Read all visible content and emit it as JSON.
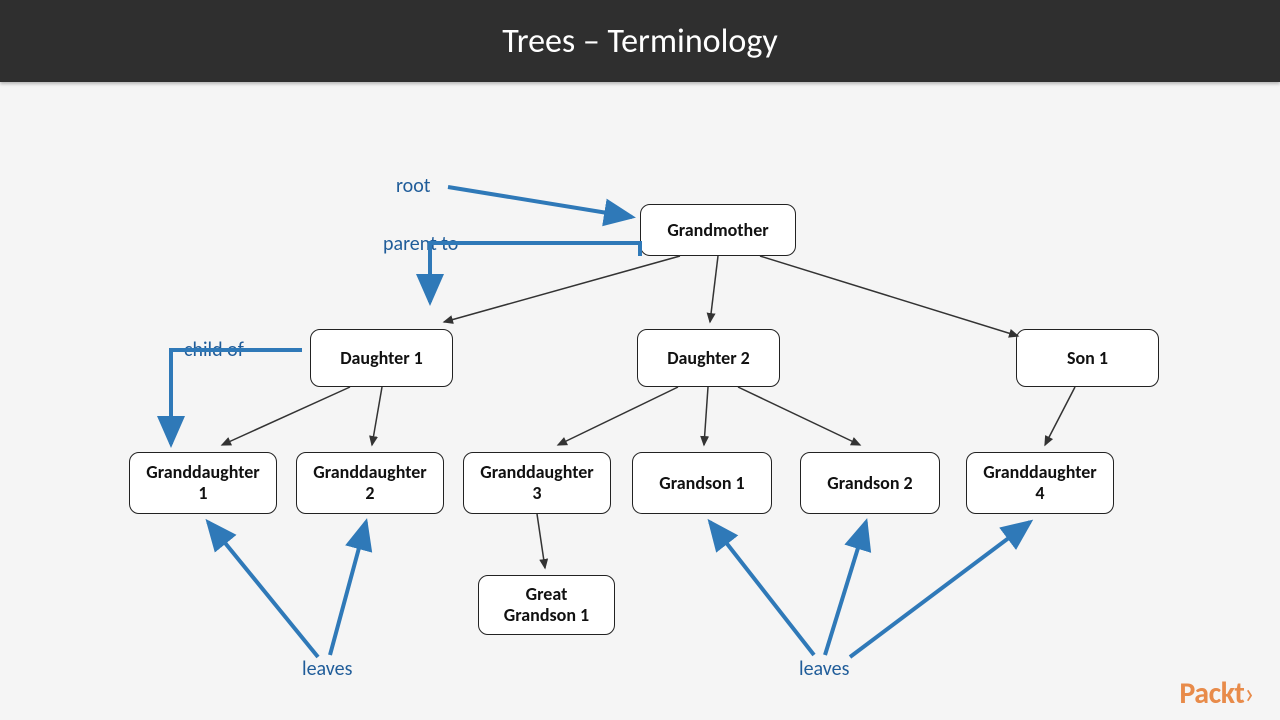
{
  "header": {
    "title": "Trees – Terminology"
  },
  "labels": {
    "root": "root",
    "parent": "parent to",
    "child": "child of",
    "leaves": "leaves"
  },
  "nodes": {
    "grandmother": "Grandmother",
    "daughter1": "Daughter 1",
    "daughter2": "Daughter 2",
    "son1": "Son 1",
    "gd1": "Granddaughter\n1",
    "gd2": "Granddaughter\n2",
    "gd3": "Granddaughter\n3",
    "gs1": "Grandson 1",
    "gs2": "Grandson 2",
    "gd4": "Granddaughter\n4",
    "ggs1": "Great\nGrandson 1"
  },
  "brand": "Packt",
  "colors": {
    "annotation": "#2F79B8",
    "tree": "#333333"
  }
}
